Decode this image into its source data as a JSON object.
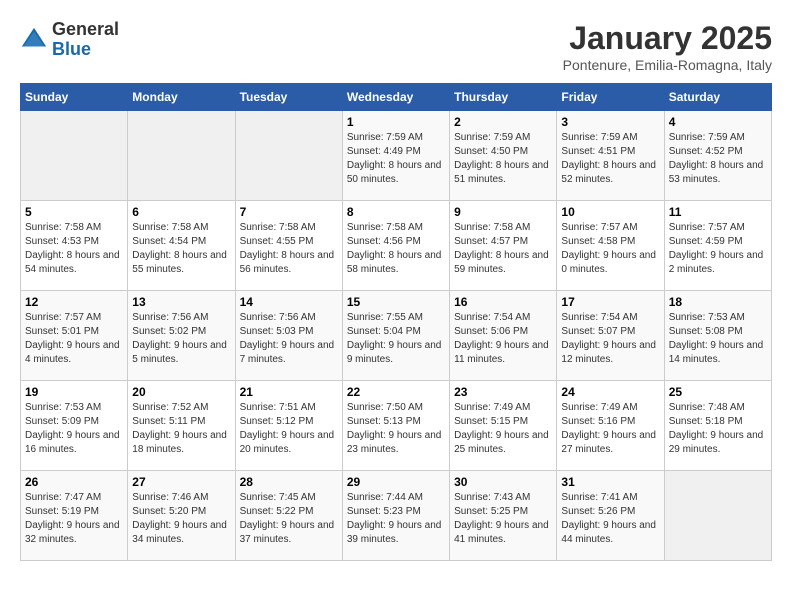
{
  "header": {
    "logo_general": "General",
    "logo_blue": "Blue",
    "month_title": "January 2025",
    "location": "Pontenure, Emilia-Romagna, Italy"
  },
  "days_of_week": [
    "Sunday",
    "Monday",
    "Tuesday",
    "Wednesday",
    "Thursday",
    "Friday",
    "Saturday"
  ],
  "weeks": [
    [
      {
        "day": "",
        "sunrise": "",
        "sunset": "",
        "daylight": "",
        "empty": true
      },
      {
        "day": "",
        "sunrise": "",
        "sunset": "",
        "daylight": "",
        "empty": true
      },
      {
        "day": "",
        "sunrise": "",
        "sunset": "",
        "daylight": "",
        "empty": true
      },
      {
        "day": "1",
        "sunrise": "Sunrise: 7:59 AM",
        "sunset": "Sunset: 4:49 PM",
        "daylight": "Daylight: 8 hours and 50 minutes.",
        "empty": false
      },
      {
        "day": "2",
        "sunrise": "Sunrise: 7:59 AM",
        "sunset": "Sunset: 4:50 PM",
        "daylight": "Daylight: 8 hours and 51 minutes.",
        "empty": false
      },
      {
        "day": "3",
        "sunrise": "Sunrise: 7:59 AM",
        "sunset": "Sunset: 4:51 PM",
        "daylight": "Daylight: 8 hours and 52 minutes.",
        "empty": false
      },
      {
        "day": "4",
        "sunrise": "Sunrise: 7:59 AM",
        "sunset": "Sunset: 4:52 PM",
        "daylight": "Daylight: 8 hours and 53 minutes.",
        "empty": false
      }
    ],
    [
      {
        "day": "5",
        "sunrise": "Sunrise: 7:58 AM",
        "sunset": "Sunset: 4:53 PM",
        "daylight": "Daylight: 8 hours and 54 minutes.",
        "empty": false
      },
      {
        "day": "6",
        "sunrise": "Sunrise: 7:58 AM",
        "sunset": "Sunset: 4:54 PM",
        "daylight": "Daylight: 8 hours and 55 minutes.",
        "empty": false
      },
      {
        "day": "7",
        "sunrise": "Sunrise: 7:58 AM",
        "sunset": "Sunset: 4:55 PM",
        "daylight": "Daylight: 8 hours and 56 minutes.",
        "empty": false
      },
      {
        "day": "8",
        "sunrise": "Sunrise: 7:58 AM",
        "sunset": "Sunset: 4:56 PM",
        "daylight": "Daylight: 8 hours and 58 minutes.",
        "empty": false
      },
      {
        "day": "9",
        "sunrise": "Sunrise: 7:58 AM",
        "sunset": "Sunset: 4:57 PM",
        "daylight": "Daylight: 8 hours and 59 minutes.",
        "empty": false
      },
      {
        "day": "10",
        "sunrise": "Sunrise: 7:57 AM",
        "sunset": "Sunset: 4:58 PM",
        "daylight": "Daylight: 9 hours and 0 minutes.",
        "empty": false
      },
      {
        "day": "11",
        "sunrise": "Sunrise: 7:57 AM",
        "sunset": "Sunset: 4:59 PM",
        "daylight": "Daylight: 9 hours and 2 minutes.",
        "empty": false
      }
    ],
    [
      {
        "day": "12",
        "sunrise": "Sunrise: 7:57 AM",
        "sunset": "Sunset: 5:01 PM",
        "daylight": "Daylight: 9 hours and 4 minutes.",
        "empty": false
      },
      {
        "day": "13",
        "sunrise": "Sunrise: 7:56 AM",
        "sunset": "Sunset: 5:02 PM",
        "daylight": "Daylight: 9 hours and 5 minutes.",
        "empty": false
      },
      {
        "day": "14",
        "sunrise": "Sunrise: 7:56 AM",
        "sunset": "Sunset: 5:03 PM",
        "daylight": "Daylight: 9 hours and 7 minutes.",
        "empty": false
      },
      {
        "day": "15",
        "sunrise": "Sunrise: 7:55 AM",
        "sunset": "Sunset: 5:04 PM",
        "daylight": "Daylight: 9 hours and 9 minutes.",
        "empty": false
      },
      {
        "day": "16",
        "sunrise": "Sunrise: 7:54 AM",
        "sunset": "Sunset: 5:06 PM",
        "daylight": "Daylight: 9 hours and 11 minutes.",
        "empty": false
      },
      {
        "day": "17",
        "sunrise": "Sunrise: 7:54 AM",
        "sunset": "Sunset: 5:07 PM",
        "daylight": "Daylight: 9 hours and 12 minutes.",
        "empty": false
      },
      {
        "day": "18",
        "sunrise": "Sunrise: 7:53 AM",
        "sunset": "Sunset: 5:08 PM",
        "daylight": "Daylight: 9 hours and 14 minutes.",
        "empty": false
      }
    ],
    [
      {
        "day": "19",
        "sunrise": "Sunrise: 7:53 AM",
        "sunset": "Sunset: 5:09 PM",
        "daylight": "Daylight: 9 hours and 16 minutes.",
        "empty": false
      },
      {
        "day": "20",
        "sunrise": "Sunrise: 7:52 AM",
        "sunset": "Sunset: 5:11 PM",
        "daylight": "Daylight: 9 hours and 18 minutes.",
        "empty": false
      },
      {
        "day": "21",
        "sunrise": "Sunrise: 7:51 AM",
        "sunset": "Sunset: 5:12 PM",
        "daylight": "Daylight: 9 hours and 20 minutes.",
        "empty": false
      },
      {
        "day": "22",
        "sunrise": "Sunrise: 7:50 AM",
        "sunset": "Sunset: 5:13 PM",
        "daylight": "Daylight: 9 hours and 23 minutes.",
        "empty": false
      },
      {
        "day": "23",
        "sunrise": "Sunrise: 7:49 AM",
        "sunset": "Sunset: 5:15 PM",
        "daylight": "Daylight: 9 hours and 25 minutes.",
        "empty": false
      },
      {
        "day": "24",
        "sunrise": "Sunrise: 7:49 AM",
        "sunset": "Sunset: 5:16 PM",
        "daylight": "Daylight: 9 hours and 27 minutes.",
        "empty": false
      },
      {
        "day": "25",
        "sunrise": "Sunrise: 7:48 AM",
        "sunset": "Sunset: 5:18 PM",
        "daylight": "Daylight: 9 hours and 29 minutes.",
        "empty": false
      }
    ],
    [
      {
        "day": "26",
        "sunrise": "Sunrise: 7:47 AM",
        "sunset": "Sunset: 5:19 PM",
        "daylight": "Daylight: 9 hours and 32 minutes.",
        "empty": false
      },
      {
        "day": "27",
        "sunrise": "Sunrise: 7:46 AM",
        "sunset": "Sunset: 5:20 PM",
        "daylight": "Daylight: 9 hours and 34 minutes.",
        "empty": false
      },
      {
        "day": "28",
        "sunrise": "Sunrise: 7:45 AM",
        "sunset": "Sunset: 5:22 PM",
        "daylight": "Daylight: 9 hours and 37 minutes.",
        "empty": false
      },
      {
        "day": "29",
        "sunrise": "Sunrise: 7:44 AM",
        "sunset": "Sunset: 5:23 PM",
        "daylight": "Daylight: 9 hours and 39 minutes.",
        "empty": false
      },
      {
        "day": "30",
        "sunrise": "Sunrise: 7:43 AM",
        "sunset": "Sunset: 5:25 PM",
        "daylight": "Daylight: 9 hours and 41 minutes.",
        "empty": false
      },
      {
        "day": "31",
        "sunrise": "Sunrise: 7:41 AM",
        "sunset": "Sunset: 5:26 PM",
        "daylight": "Daylight: 9 hours and 44 minutes.",
        "empty": false
      },
      {
        "day": "",
        "sunrise": "",
        "sunset": "",
        "daylight": "",
        "empty": true
      }
    ]
  ]
}
